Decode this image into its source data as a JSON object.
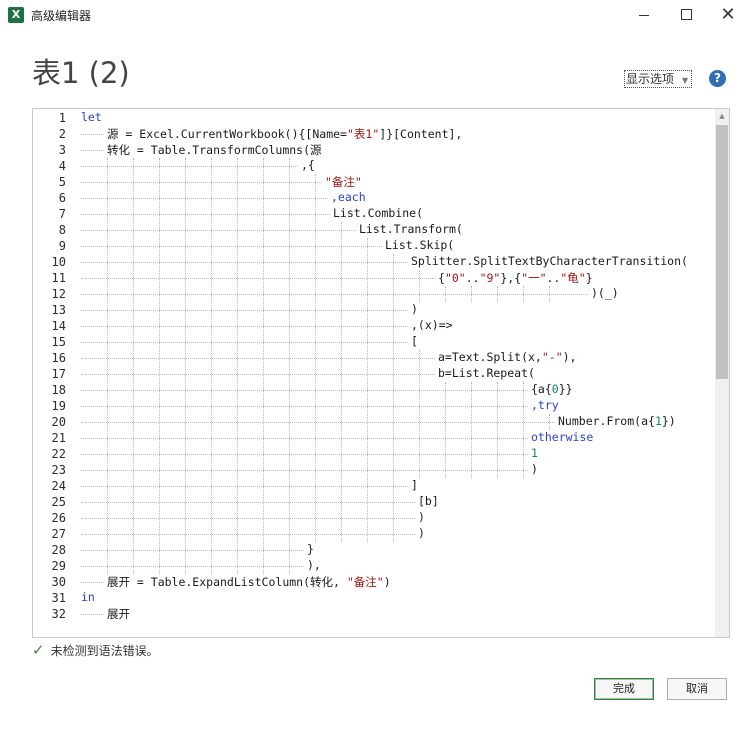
{
  "window": {
    "icon_label": "X",
    "title": "高级编辑器",
    "minimize_icon": "minimize-icon",
    "maximize_icon": "maximize-icon",
    "close_icon": "close-icon"
  },
  "query_title": "表1 (2)",
  "display_options": {
    "label": "显示选项",
    "icon": "chevron-down-icon"
  },
  "help": {
    "label": "?",
    "icon": "help-icon"
  },
  "colors": {
    "keyword": "#2a3fd0",
    "string": "#a31515",
    "number": "#09885a",
    "status_check": "#3a8a3a",
    "help_circle": "#2f6db5"
  },
  "editor": {
    "line_numbers": [
      "1",
      "2",
      "3",
      "4",
      "5",
      "6",
      "7",
      "8",
      "9",
      "10",
      "11",
      "12",
      "13",
      "14",
      "15",
      "16",
      "17",
      "18",
      "19",
      "20",
      "21",
      "22",
      "23",
      "24",
      "25",
      "26",
      "27",
      "28",
      "29",
      "30",
      "31",
      "32"
    ],
    "lines": [
      [
        {
          "t": "let",
          "c": "kw"
        }
      ],
      [
        {
          "t": "源 = Excel.CurrentWorkbook(){[Name=",
          "c": ""
        },
        {
          "t": "\"表1\"",
          "c": "str"
        },
        {
          "t": "]}[Content],",
          "c": ""
        }
      ],
      [
        {
          "t": "转化 = Table.TransformColumns(源",
          "c": ""
        }
      ],
      [
        {
          "t": ",{",
          "c": ""
        }
      ],
      [
        {
          "t": "\"备注\"",
          "c": "str"
        }
      ],
      [
        {
          "t": ",each",
          "c": "kw"
        }
      ],
      [
        {
          "t": "List.Combine(",
          "c": ""
        }
      ],
      [
        {
          "t": "List.Transform(",
          "c": ""
        }
      ],
      [
        {
          "t": "List.Skip(",
          "c": ""
        }
      ],
      [
        {
          "t": "Splitter.SplitTextByCharacterTransition(",
          "c": ""
        }
      ],
      [
        {
          "t": "{",
          "c": ""
        },
        {
          "t": "\"0\"",
          "c": "str"
        },
        {
          "t": "..",
          "c": ""
        },
        {
          "t": "\"9\"",
          "c": "str"
        },
        {
          "t": "},{",
          "c": ""
        },
        {
          "t": "\"一\"",
          "c": "str"
        },
        {
          "t": "..",
          "c": ""
        },
        {
          "t": "\"龟\"",
          "c": "str"
        },
        {
          "t": "}",
          "c": ""
        }
      ],
      [
        {
          "t": ")(_)",
          "c": ""
        }
      ],
      [
        {
          "t": ")",
          "c": ""
        }
      ],
      [
        {
          "t": ",(x)=>",
          "c": ""
        }
      ],
      [
        {
          "t": "[",
          "c": ""
        }
      ],
      [
        {
          "t": "a=Text.Split(x,",
          "c": ""
        },
        {
          "t": "\"-\"",
          "c": "str"
        },
        {
          "t": "),",
          "c": ""
        }
      ],
      [
        {
          "t": "b=List.Repeat(",
          "c": ""
        }
      ],
      [
        {
          "t": "{a{",
          "c": ""
        },
        {
          "t": "0",
          "c": "num"
        },
        {
          "t": "}}",
          "c": ""
        }
      ],
      [
        {
          "t": ",try",
          "c": "kw"
        }
      ],
      [
        {
          "t": "Number.From(a{",
          "c": ""
        },
        {
          "t": "1",
          "c": "num"
        },
        {
          "t": "})",
          "c": ""
        }
      ],
      [
        {
          "t": "otherwise",
          "c": "kw"
        }
      ],
      [
        {
          "t": "1",
          "c": "num"
        }
      ],
      [
        {
          "t": ")",
          "c": ""
        }
      ],
      [
        {
          "t": "]",
          "c": ""
        }
      ],
      [
        {
          "t": "[b]",
          "c": ""
        }
      ],
      [
        {
          "t": ")",
          "c": ""
        }
      ],
      [
        {
          "t": ")",
          "c": ""
        }
      ],
      [
        {
          "t": "}",
          "c": ""
        }
      ],
      [
        {
          "t": "),",
          "c": ""
        }
      ],
      [
        {
          "t": "展开 = Table.ExpandListColumn(转化, ",
          "c": ""
        },
        {
          "t": "\"备注\"",
          "c": "str"
        },
        {
          "t": ")",
          "c": ""
        }
      ],
      [
        {
          "t": "in",
          "c": "kw"
        }
      ],
      [
        {
          "t": "展开",
          "c": ""
        }
      ]
    ]
  },
  "status": {
    "icon": "checkmark-icon",
    "text": "未检测到语法错误。"
  },
  "buttons": {
    "done": "完成",
    "cancel": "取消"
  }
}
